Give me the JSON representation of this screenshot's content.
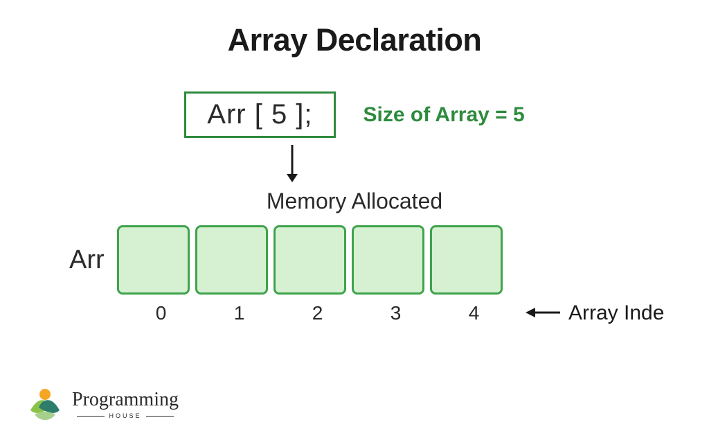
{
  "title": "Array Declaration",
  "declaration": "Arr [ 5 ];",
  "sizeText": "Size of Array = 5",
  "memoryLabel": "Memory Allocated",
  "arrLabel": "Arr",
  "indices": [
    "0",
    "1",
    "2",
    "3",
    "4"
  ],
  "arrayIndexLabel": "Array Inde",
  "logo": {
    "name": "Programming",
    "sub": "HOUSE"
  }
}
